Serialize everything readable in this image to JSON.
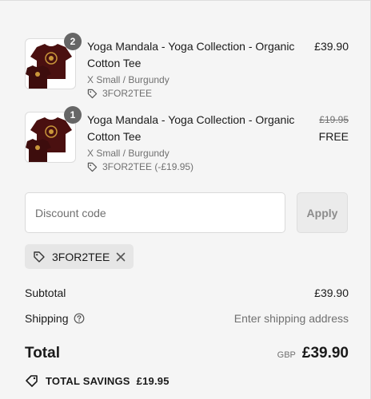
{
  "line_items": [
    {
      "title": "Yoga Mandala - Yoga Collection - Organic Cotton Tee",
      "variant": "X Small / Burgundy",
      "discount": "3FOR2TEE",
      "quantity": "2",
      "price": "£39.90",
      "original_price": ""
    },
    {
      "title": "Yoga Mandala - Yoga Collection - Organic Cotton Tee",
      "variant": "X Small / Burgundy",
      "discount": "3FOR2TEE (-£19.95)",
      "quantity": "1",
      "price": "FREE",
      "original_price": "£19.95"
    }
  ],
  "discount_form": {
    "placeholder": "Discount code",
    "value": "",
    "apply_label": "Apply"
  },
  "applied_code": "3FOR2TEE",
  "summary": {
    "subtotal_label": "Subtotal",
    "subtotal_value": "£39.90",
    "shipping_label": "Shipping",
    "shipping_value": "Enter shipping address",
    "total_label": "Total",
    "currency": "GBP",
    "total_value": "£39.90",
    "savings_label": "TOTAL SAVINGS",
    "savings_value": "£19.95"
  },
  "colors": {
    "background": "#f5f5f5",
    "shirt": "#4a1010",
    "badge": "#666666",
    "muted_text": "#707070"
  }
}
